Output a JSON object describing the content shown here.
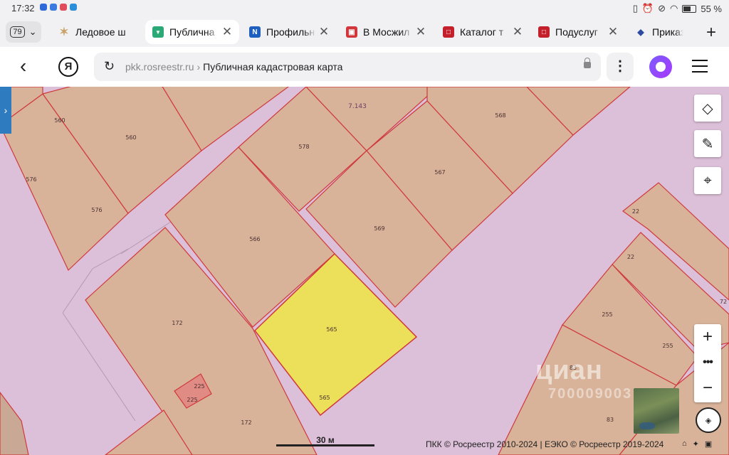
{
  "status": {
    "time": "17:32",
    "battery": "55 %"
  },
  "tabs": {
    "count": "79",
    "items": [
      {
        "title": "Ледовое ш",
        "color": "#c9a46a",
        "glyph": "✶"
      },
      {
        "title": "Публична",
        "color": "#2aa876",
        "glyph": "▼",
        "active": true
      },
      {
        "title": "Профильн",
        "color": "#1f5fbf",
        "glyph": "N"
      },
      {
        "title": "В Мосжил",
        "color": "#d2353a",
        "glyph": "▣"
      },
      {
        "title": "Каталог т",
        "color": "#c4202c",
        "glyph": "□"
      },
      {
        "title": "Подуслуг",
        "color": "#c4202c",
        "glyph": "□"
      },
      {
        "title": "Приказ",
        "color": "#2c4aa0",
        "glyph": "◆"
      }
    ],
    "new_tab": "+"
  },
  "address": {
    "domain": "pkk.rosreestr.ru",
    "separator": "›",
    "page_title": "Публичная кадастровая карта",
    "yandex": "Я",
    "menu": "⋮"
  },
  "map": {
    "selected_parcel": "565",
    "scale": "30 м",
    "copyright": "ПКК © Росреестр 2010-2024 | ЕЭКО © Росреестр 2019-2024",
    "watermark": "циан",
    "watermark_sub": "700009003",
    "labels": [
      "560",
      "560",
      "576",
      "576",
      "578",
      "7.143",
      "568",
      "567",
      "569",
      "566",
      "565",
      "565",
      "172",
      "172",
      "225",
      "225",
      "22",
      "22",
      "255",
      "255",
      "83",
      "83",
      "72"
    ],
    "controls": {
      "zoom_in": "+",
      "more": "•••",
      "zoom_out": "−"
    }
  },
  "colors": {
    "parcel": "#d8b39a",
    "selected": "#ece05a",
    "border": "#d0393b",
    "quarter": "#dcbfd8"
  }
}
